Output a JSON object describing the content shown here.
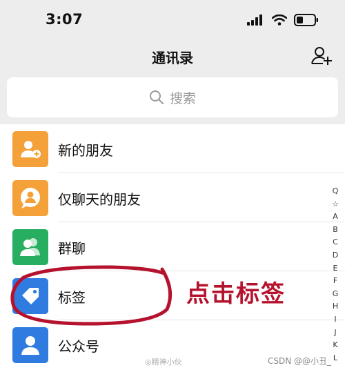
{
  "status_bar": {
    "time": "3:07"
  },
  "header": {
    "title": "通讯录"
  },
  "search": {
    "placeholder": "搜索"
  },
  "list": [
    {
      "label": "新的朋友",
      "color": "#f5a13a",
      "icon": "add-person-icon"
    },
    {
      "label": "仅聊天的朋友",
      "color": "#f5a13a",
      "icon": "chat-person-icon"
    },
    {
      "label": "群聊",
      "color": "#27ae60",
      "icon": "group-icon"
    },
    {
      "label": "标签",
      "color": "#2f7be0",
      "icon": "tag-icon"
    },
    {
      "label": "公众号",
      "color": "#2f7be0",
      "icon": "official-account-icon"
    }
  ],
  "index_letters": [
    "Q",
    "☆",
    "A",
    "B",
    "C",
    "D",
    "E",
    "F",
    "G",
    "H",
    "I",
    "J",
    "K",
    "L"
  ],
  "annotation": {
    "text": "点击标签",
    "color": "#b5122d"
  },
  "watermarks": {
    "weibo": "◎精神小伙",
    "csdn": "CSDN @@小丑_"
  }
}
